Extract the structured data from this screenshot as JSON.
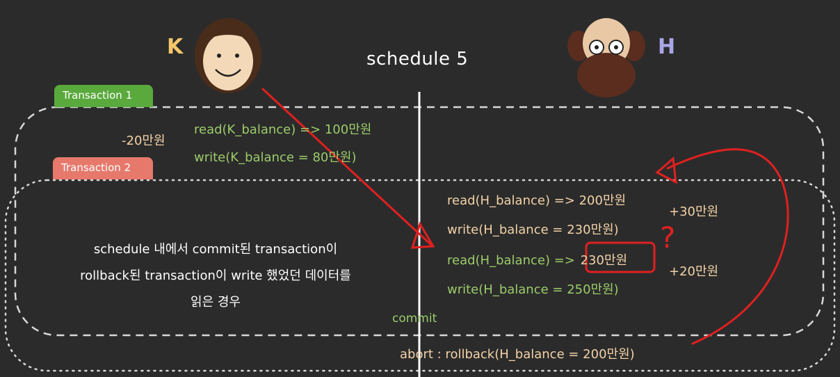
{
  "title": "schedule 5",
  "participants": {
    "k": {
      "label": "K",
      "color": "#f5c76a"
    },
    "h": {
      "label": "H",
      "color": "#a9a6e6"
    }
  },
  "transactions": {
    "t1": {
      "label": "Transaction 1",
      "color": "#5aa93c"
    },
    "t2": {
      "label": "Transaction 2",
      "color": "#e6796c"
    }
  },
  "left_ops": {
    "k_change": "-20만원",
    "read_k": "read(K_balance) => 100만원",
    "write_k": "write(K_balance = 80만원)"
  },
  "right_ops": {
    "read_h1": "read(H_balance) => 200만원",
    "write_h1": "write(H_balance = 230만원)",
    "read_h2_prefix": "read(H_balance) =>",
    "read_h2_value": "230만원",
    "write_h2": "write(H_balance = 250만원)",
    "h_change_1": "+30만원",
    "h_change_2": "+20만원"
  },
  "description": {
    "line1": "schedule 내에서 commit된 transaction이",
    "line2": "rollback된 transaction이 write 했었던 데이터를",
    "line3": "읽은 경우"
  },
  "commit_label": "commit",
  "abort_label": "abort : rollback(H_balance = 200만원)",
  "annotation": {
    "question_mark": "?"
  }
}
